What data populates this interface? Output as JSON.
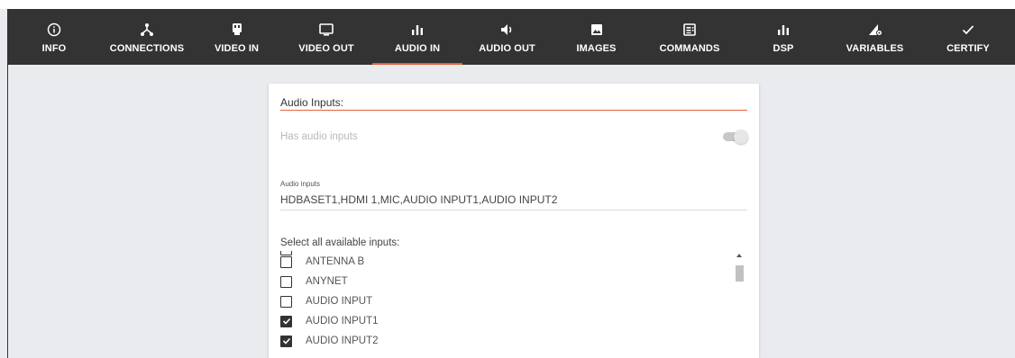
{
  "nav": {
    "items": [
      {
        "label": "INFO",
        "icon": "info-icon"
      },
      {
        "label": "CONNECTIONS",
        "icon": "connections-icon"
      },
      {
        "label": "VIDEO IN",
        "icon": "video-in-icon"
      },
      {
        "label": "VIDEO OUT",
        "icon": "monitor-icon"
      },
      {
        "label": "AUDIO IN",
        "icon": "bar-chart-icon",
        "active": true
      },
      {
        "label": "AUDIO OUT",
        "icon": "speaker-icon"
      },
      {
        "label": "IMAGES",
        "icon": "image-icon"
      },
      {
        "label": "COMMANDS",
        "icon": "commands-icon"
      },
      {
        "label": "DSP",
        "icon": "bar-chart-icon"
      },
      {
        "label": "VARIABLES",
        "icon": "variables-icon"
      },
      {
        "label": "CERTIFY",
        "icon": "check-icon"
      }
    ],
    "accent_color": "#e8603a"
  },
  "card": {
    "section_title": "Audio Inputs:",
    "has_audio_inputs_label": "Has audio inputs",
    "has_audio_inputs_on": true,
    "audio_inputs_label": "Audio inputs",
    "audio_inputs_value": "HDBASET1,HDMI 1,MIC,AUDIO INPUT1,AUDIO INPUT2",
    "select_label": "Select all available inputs:",
    "inputs": [
      {
        "label": "ANTENNA B",
        "checked": false
      },
      {
        "label": "ANYNET",
        "checked": false
      },
      {
        "label": "AUDIO INPUT",
        "checked": false
      },
      {
        "label": "AUDIO INPUT1",
        "checked": true
      },
      {
        "label": "AUDIO INPUT2",
        "checked": true
      }
    ]
  }
}
